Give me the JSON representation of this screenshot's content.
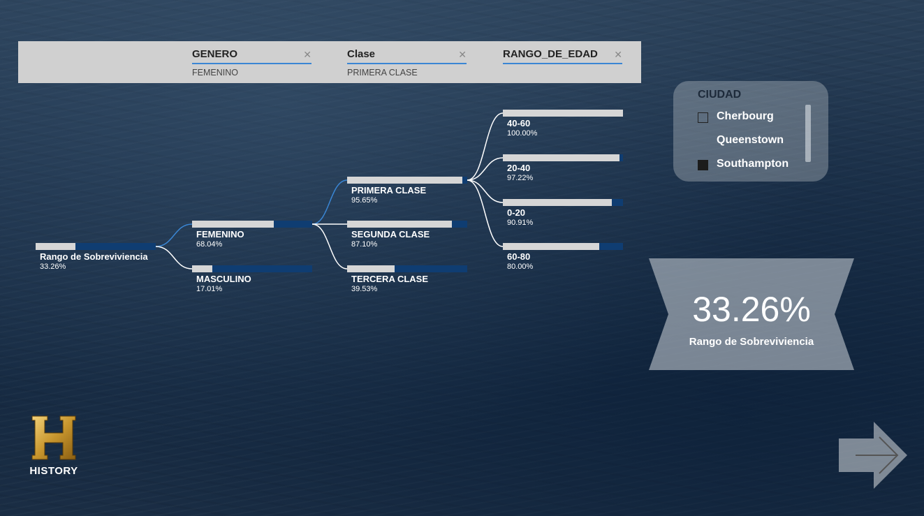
{
  "filters": [
    {
      "title": "GENERO",
      "value": "FEMENINO"
    },
    {
      "title": "Clase",
      "value": "PRIMERA CLASE"
    },
    {
      "title": "RANGO_DE_EDAD",
      "value": ""
    }
  ],
  "tree": {
    "root": {
      "label": "Rango de Sobreviviencia",
      "pct": "33.26%",
      "value": 33.26
    },
    "level1": [
      {
        "label": "FEMENINO",
        "pct": "68.04%",
        "value": 68.04,
        "selected": true
      },
      {
        "label": "MASCULINO",
        "pct": "17.01%",
        "value": 17.01
      }
    ],
    "level2": [
      {
        "label": "PRIMERA CLASE",
        "pct": "95.65%",
        "value": 95.65,
        "selected": true
      },
      {
        "label": "SEGUNDA CLASE",
        "pct": "87.10%",
        "value": 87.1
      },
      {
        "label": "TERCERA CLASE",
        "pct": "39.53%",
        "value": 39.53
      }
    ],
    "level3": [
      {
        "label": "40-60",
        "pct": "100.00%",
        "value": 100.0
      },
      {
        "label": "20-40",
        "pct": "97.22%",
        "value": 97.22
      },
      {
        "label": "0-20",
        "pct": "90.91%",
        "value": 90.91
      },
      {
        "label": "60-80",
        "pct": "80.00%",
        "value": 80.0
      }
    ]
  },
  "city": {
    "title": "CIUDAD",
    "items": [
      {
        "label": "Cherbourg",
        "checked": false
      },
      {
        "label": "Queenstown",
        "checked": false
      },
      {
        "label": "Southampton",
        "checked": true
      }
    ]
  },
  "kpi": {
    "value": "33.26%",
    "label": "Rango de Sobreviviencia"
  },
  "logo": {
    "text": "HISTORY",
    "icon": "history-h-logo"
  },
  "nav": {
    "icon": "arrow-right-icon"
  },
  "colors": {
    "bar_fill": "#d6d6d6",
    "bar_bg": "#0f3d72",
    "selected_link": "#3a86d4",
    "link": "#ffffff"
  }
}
